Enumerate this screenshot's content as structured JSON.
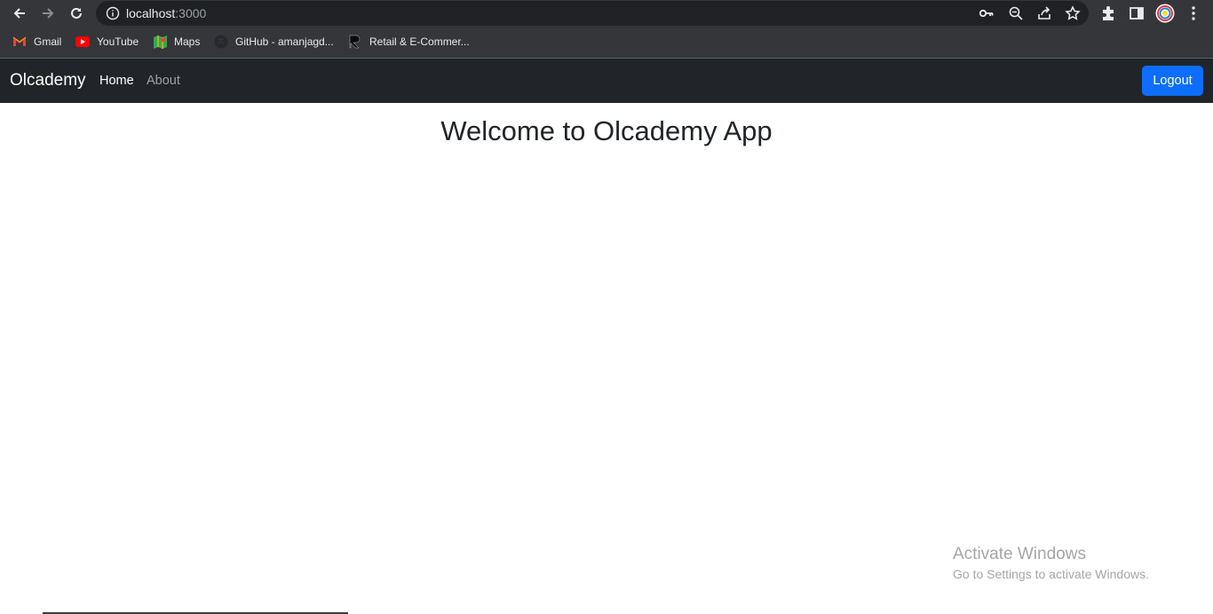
{
  "browser": {
    "url_host": "localhost",
    "url_port": ":3000",
    "bookmarks": [
      {
        "label": "Gmail",
        "icon": "gmail-icon"
      },
      {
        "label": "YouTube",
        "icon": "youtube-icon"
      },
      {
        "label": "Maps",
        "icon": "maps-icon"
      },
      {
        "label": "GitHub - amanjagd...",
        "icon": "github-icon"
      },
      {
        "label": "Retail & E-Commer...",
        "icon": "retail-icon"
      }
    ]
  },
  "navbar": {
    "brand": "Olcademy",
    "links": [
      {
        "label": "Home",
        "active": true
      },
      {
        "label": "About",
        "active": false
      }
    ],
    "logout_label": "Logout"
  },
  "main": {
    "heading": "Welcome to Olcademy App"
  },
  "watermark": {
    "title": "Activate Windows",
    "subtitle": "Go to Settings to activate Windows."
  },
  "colors": {
    "navbar_bg": "#212529",
    "button_primary": "#0d6efd",
    "chrome_bg": "#35363a"
  }
}
